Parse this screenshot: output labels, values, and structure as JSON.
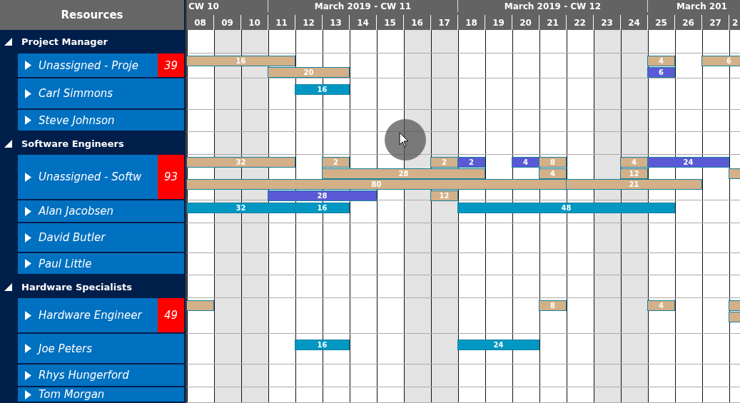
{
  "resources_header": "Resources",
  "weeks": [
    {
      "label": "CW 10",
      "days": [
        {
          "label": "08",
          "weekend": false
        },
        {
          "label": "09",
          "weekend": true
        },
        {
          "label": "10",
          "weekend": true
        }
      ]
    },
    {
      "label": "March 2019 - CW 11",
      "days": [
        {
          "label": "11",
          "weekend": false
        },
        {
          "label": "12",
          "weekend": false
        },
        {
          "label": "13",
          "weekend": false
        },
        {
          "label": "14",
          "weekend": false
        },
        {
          "label": "15",
          "weekend": false
        },
        {
          "label": "16",
          "weekend": true
        },
        {
          "label": "17",
          "weekend": true
        }
      ]
    },
    {
      "label": "March 2019 - CW 12",
      "days": [
        {
          "label": "18",
          "weekend": false
        },
        {
          "label": "19",
          "weekend": false
        },
        {
          "label": "20",
          "weekend": false
        },
        {
          "label": "21",
          "weekend": false
        },
        {
          "label": "22",
          "weekend": false
        },
        {
          "label": "23",
          "weekend": true
        },
        {
          "label": "24",
          "weekend": true
        }
      ]
    },
    {
      "label": "March 201",
      "days": [
        {
          "label": "25",
          "weekend": false
        },
        {
          "label": "26",
          "weekend": false
        },
        {
          "label": "27",
          "weekend": false
        },
        {
          "label": "2",
          "weekend": false
        }
      ]
    }
  ],
  "groups": [
    {
      "name": "Project Manager",
      "expanded": true,
      "resources": [
        {
          "name": "Unassigned - Proje",
          "badge": "39",
          "expanded": false,
          "lanes": [
            [
              {
                "kind": "bar",
                "label": "16",
                "color": "#d3b088"
              },
              {
                "kind": "cont"
              },
              {
                "kind": "cont"
              },
              {
                "kind": "cont"
              },
              {
                "kind": "gap"
              },
              {
                "kind": "gap"
              },
              {
                "kind": "gap"
              },
              {
                "kind": "gap"
              },
              {
                "kind": "gap"
              },
              {
                "kind": "gap"
              },
              {
                "kind": "gap"
              },
              {
                "kind": "gap"
              },
              {
                "kind": "gap"
              },
              {
                "kind": "gap"
              },
              {
                "kind": "gap"
              },
              {
                "kind": "gap"
              },
              {
                "kind": "gap"
              },
              {
                "kind": "bar",
                "label": "4",
                "color": "#d3b088"
              },
              {
                "kind": "gap"
              },
              {
                "kind": "bar",
                "label": "6",
                "color": "#d3b088"
              },
              {
                "kind": "cont"
              }
            ],
            [
              {
                "kind": "gap"
              },
              {
                "kind": "gap"
              },
              {
                "kind": "gap"
              },
              {
                "kind": "bar",
                "label": "20",
                "color": "#d3b088"
              },
              {
                "kind": "cont"
              },
              {
                "kind": "cont"
              },
              {
                "kind": "gap"
              },
              {
                "kind": "gap"
              },
              {
                "kind": "gap"
              },
              {
                "kind": "gap"
              },
              {
                "kind": "gap"
              },
              {
                "kind": "gap"
              },
              {
                "kind": "gap"
              },
              {
                "kind": "gap"
              },
              {
                "kind": "gap"
              },
              {
                "kind": "gap"
              },
              {
                "kind": "gap"
              },
              {
                "kind": "bar",
                "label": "6",
                "color": "#5a5ad6"
              }
            ]
          ]
        },
        {
          "name": "Carl Simmons",
          "expanded": false,
          "lanes": [
            [
              {
                "kind": "gap"
              },
              {
                "kind": "gap"
              },
              {
                "kind": "gap"
              },
              {
                "kind": "gap"
              },
              {
                "kind": "bar",
                "label": "16",
                "color": "#0097c3"
              },
              {
                "kind": "cont"
              }
            ]
          ]
        },
        {
          "name": "Steve Johnson",
          "expanded": false
        }
      ]
    },
    {
      "name": "Software Engineers",
      "expanded": true,
      "resources": [
        {
          "name": "Unassigned - Softw",
          "badge": "93",
          "expanded": false,
          "lanes": [
            [
              {
                "kind": "bar",
                "label": "32",
                "color": "#d3b088"
              },
              {
                "kind": "cont"
              },
              {
                "kind": "cont"
              },
              {
                "kind": "cont"
              },
              {
                "kind": "gap"
              },
              {
                "kind": "bar",
                "label": "2",
                "color": "#d3b088"
              },
              {
                "kind": "gap"
              },
              {
                "kind": "gap"
              },
              {
                "kind": "gap"
              },
              {
                "kind": "bar",
                "label": "2",
                "color": "#d3b088"
              },
              {
                "kind": "bar",
                "label": "2",
                "color": "#5a5ad6"
              },
              {
                "kind": "gap"
              },
              {
                "kind": "bar",
                "label": "4",
                "color": "#5a5ad6"
              },
              {
                "kind": "bar",
                "label": "8",
                "color": "#d3b088"
              },
              {
                "kind": "gap"
              },
              {
                "kind": "gap"
              },
              {
                "kind": "bar",
                "label": "4",
                "color": "#d3b088"
              },
              {
                "kind": "bar",
                "label": "24",
                "color": "#5a5ad6"
              },
              {
                "kind": "cont"
              },
              {
                "kind": "cont"
              }
            ],
            [
              {
                "kind": "gap"
              },
              {
                "kind": "gap"
              },
              {
                "kind": "gap"
              },
              {
                "kind": "gap"
              },
              {
                "kind": "gap"
              },
              {
                "kind": "bar",
                "label": "28",
                "color": "#d3b088"
              },
              {
                "kind": "cont"
              },
              {
                "kind": "cont"
              },
              {
                "kind": "cont"
              },
              {
                "kind": "cont"
              },
              {
                "kind": "cont"
              },
              {
                "kind": "gap"
              },
              {
                "kind": "gap"
              },
              {
                "kind": "bar",
                "label": "4",
                "color": "#d3b088"
              },
              {
                "kind": "gap"
              },
              {
                "kind": "gap"
              },
              {
                "kind": "bar",
                "label": "12",
                "color": "#d3b088"
              },
              {
                "kind": "gap"
              },
              {
                "kind": "gap"
              },
              {
                "kind": "gap"
              },
              {
                "kind": "bar",
                "color": "#d3b088"
              }
            ],
            [
              {
                "kind": "bar",
                "label": "80",
                "color": "#d3b088"
              },
              {
                "kind": "cont"
              },
              {
                "kind": "cont"
              },
              {
                "kind": "cont"
              },
              {
                "kind": "cont"
              },
              {
                "kind": "cont"
              },
              {
                "kind": "cont"
              },
              {
                "kind": "cont"
              },
              {
                "kind": "cont"
              },
              {
                "kind": "cont"
              },
              {
                "kind": "cont"
              },
              {
                "kind": "cont"
              },
              {
                "kind": "cont"
              },
              {
                "kind": "cont"
              },
              {
                "kind": "bar",
                "label": "21",
                "color": "#d3b088"
              },
              {
                "kind": "cont"
              },
              {
                "kind": "cont"
              },
              {
                "kind": "cont"
              },
              {
                "kind": "cont"
              }
            ],
            [
              {
                "kind": "gap"
              },
              {
                "kind": "gap"
              },
              {
                "kind": "gap"
              },
              {
                "kind": "bar",
                "label": "28",
                "color": "#5a5ad6"
              },
              {
                "kind": "cont"
              },
              {
                "kind": "cont"
              },
              {
                "kind": "cont"
              },
              {
                "kind": "gap"
              },
              {
                "kind": "gap"
              },
              {
                "kind": "bar",
                "label": "12",
                "color": "#d3b088"
              }
            ]
          ]
        },
        {
          "name": "Alan Jacobsen",
          "expanded": false,
          "lanes": [
            [
              {
                "kind": "bar",
                "label": "32",
                "color": "#0097c3"
              },
              {
                "kind": "cont"
              },
              {
                "kind": "cont"
              },
              {
                "kind": "cont"
              },
              {
                "kind": "bar",
                "label": "16",
                "color": "#0097c3"
              },
              {
                "kind": "cont"
              },
              {
                "kind": "gap"
              },
              {
                "kind": "gap"
              },
              {
                "kind": "gap"
              },
              {
                "kind": "gap"
              },
              {
                "kind": "bar",
                "label": "48",
                "color": "#0097c3"
              },
              {
                "kind": "cont"
              },
              {
                "kind": "cont"
              },
              {
                "kind": "cont"
              },
              {
                "kind": "cont"
              },
              {
                "kind": "cont"
              },
              {
                "kind": "cont"
              },
              {
                "kind": "cont"
              }
            ]
          ]
        },
        {
          "name": "David Butler",
          "expanded": false
        },
        {
          "name": "Paul Little",
          "expanded": false
        }
      ]
    },
    {
      "name": "Hardware Specialists",
      "expanded": true,
      "resources": [
        {
          "name": "Hardware Engineer",
          "badge": "49",
          "expanded": false,
          "lanes": [
            [
              {
                "kind": "bar",
                "color": "#d3b088"
              },
              {
                "kind": "gap"
              },
              {
                "kind": "gap"
              },
              {
                "kind": "gap"
              },
              {
                "kind": "gap"
              },
              {
                "kind": "gap"
              },
              {
                "kind": "gap"
              },
              {
                "kind": "gap"
              },
              {
                "kind": "gap"
              },
              {
                "kind": "gap"
              },
              {
                "kind": "gap"
              },
              {
                "kind": "gap"
              },
              {
                "kind": "gap"
              },
              {
                "kind": "bar",
                "label": "8",
                "color": "#d3b088"
              },
              {
                "kind": "gap"
              },
              {
                "kind": "gap"
              },
              {
                "kind": "gap"
              },
              {
                "kind": "bar",
                "label": "4",
                "color": "#d3b088"
              },
              {
                "kind": "gap"
              },
              {
                "kind": "gap"
              },
              {
                "kind": "bar",
                "color": "#d3b088"
              }
            ],
            [
              {
                "kind": "gap"
              },
              {
                "kind": "gap"
              },
              {
                "kind": "gap"
              },
              {
                "kind": "gap"
              },
              {
                "kind": "gap"
              },
              {
                "kind": "gap"
              },
              {
                "kind": "gap"
              },
              {
                "kind": "gap"
              },
              {
                "kind": "gap"
              },
              {
                "kind": "gap"
              },
              {
                "kind": "gap"
              },
              {
                "kind": "gap"
              },
              {
                "kind": "gap"
              },
              {
                "kind": "gap"
              },
              {
                "kind": "gap"
              },
              {
                "kind": "gap"
              },
              {
                "kind": "gap"
              },
              {
                "kind": "gap"
              },
              {
                "kind": "gap"
              },
              {
                "kind": "gap"
              },
              {
                "kind": "bar",
                "color": "#d3b088"
              }
            ]
          ]
        },
        {
          "name": "Joe Peters",
          "expanded": false,
          "lanes": [
            [
              {
                "kind": "gap"
              },
              {
                "kind": "gap"
              },
              {
                "kind": "gap"
              },
              {
                "kind": "gap"
              },
              {
                "kind": "bar",
                "label": "16",
                "color": "#0097c3"
              },
              {
                "kind": "cont"
              },
              {
                "kind": "gap"
              },
              {
                "kind": "gap"
              },
              {
                "kind": "gap"
              },
              {
                "kind": "gap"
              },
              {
                "kind": "bar",
                "label": "24",
                "color": "#0097c3"
              },
              {
                "kind": "cont"
              },
              {
                "kind": "cont"
              }
            ]
          ]
        },
        {
          "name": "Rhys Hungerford",
          "expanded": false
        },
        {
          "name": "Tom Morgan",
          "expanded": false
        }
      ]
    }
  ]
}
